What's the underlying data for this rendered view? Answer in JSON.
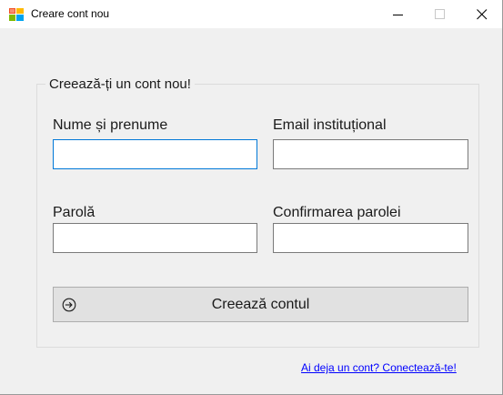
{
  "window": {
    "title": "Creare cont nou",
    "icon": "windows-form-icon",
    "controls": {
      "minimize_icon": "minimize-icon",
      "maximize_icon": "maximize-icon",
      "close_icon": "close-icon"
    }
  },
  "form": {
    "group_title": "Creează-ți un cont nou!",
    "fields": {
      "full_name": {
        "label": "Nume și prenume",
        "value": ""
      },
      "email": {
        "label": "Email instituțional",
        "value": ""
      },
      "password": {
        "label": "Parolă",
        "value": ""
      },
      "confirm_password": {
        "label": "Confirmarea parolei",
        "value": ""
      }
    },
    "submit": {
      "label": "Creează contul",
      "icon": "sign-in-arrow-icon"
    },
    "login_link": "Ai deja un cont? Conectează-te!"
  },
  "colors": {
    "window_background": "#f0f0f0",
    "titlebar_background": "#ffffff",
    "focus_border": "#0078d7",
    "button_background": "#e1e1e1",
    "link": "#0000ff"
  }
}
